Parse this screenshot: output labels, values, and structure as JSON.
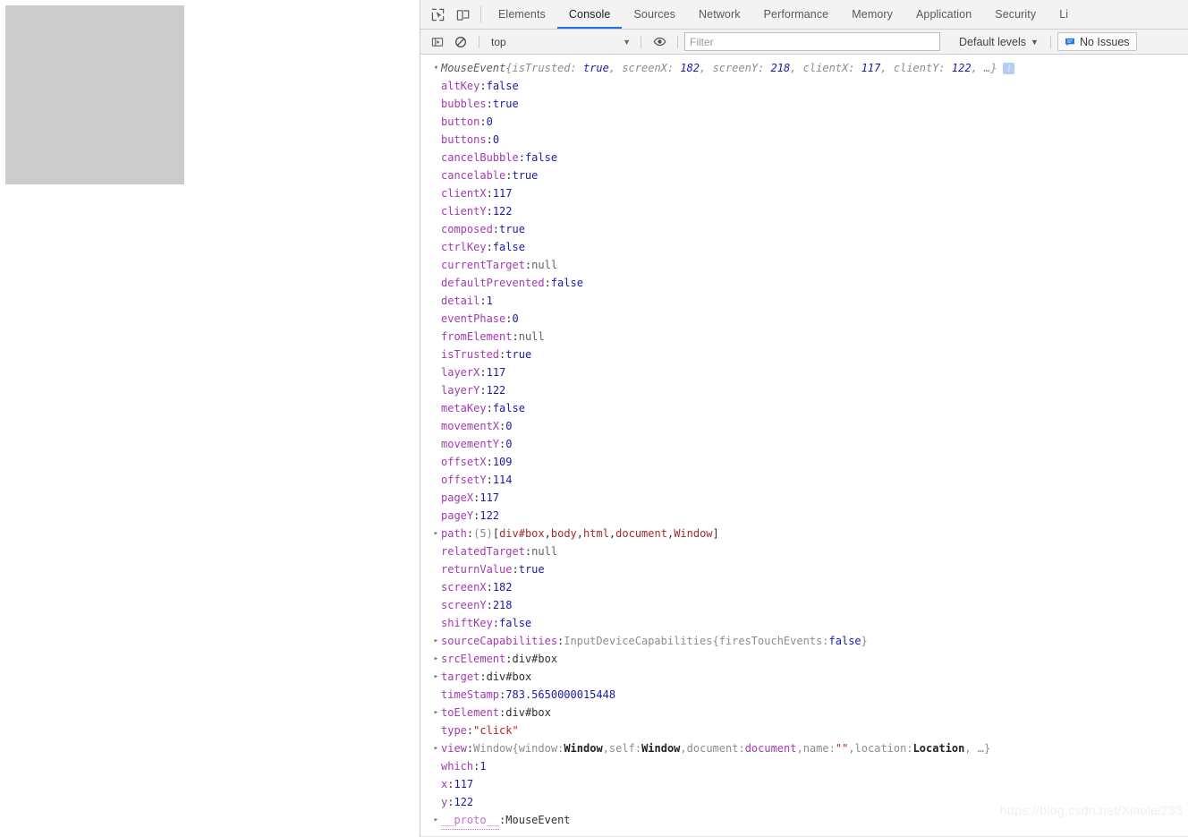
{
  "page": {
    "box_label": "div#box",
    "box_color": "#cccccc"
  },
  "devtools": {
    "toolbar_icons": [
      {
        "name": "inspect-element-icon",
        "glyph": "inspect"
      },
      {
        "name": "device-toolbar-icon",
        "glyph": "device"
      }
    ],
    "tabs": [
      {
        "label": "Elements",
        "active": false
      },
      {
        "label": "Console",
        "active": true
      },
      {
        "label": "Sources",
        "active": false
      },
      {
        "label": "Network",
        "active": false
      },
      {
        "label": "Performance",
        "active": false
      },
      {
        "label": "Memory",
        "active": false
      },
      {
        "label": "Application",
        "active": false
      },
      {
        "label": "Security",
        "active": false
      },
      {
        "label": "Li",
        "active": false
      }
    ]
  },
  "console_toolbar": {
    "sidebar_toggle_icon": "console-sidebar-icon",
    "clear_console_icon": "clear-console-icon",
    "context": "top",
    "context_caret": "▼",
    "eye_icon": "live-expression-eye-icon",
    "filter_placeholder": "Filter",
    "filter_value": "",
    "levels_label": "Default levels",
    "levels_caret": "▼",
    "issues_icon": "issues-message-icon",
    "issues_label": "No Issues",
    "issues_accent": "#1a73e8"
  },
  "console_log": {
    "header": {
      "arrow": "▾",
      "class_name": "MouseEvent",
      "preview_open": " {",
      "preview_items": [
        {
          "key": "isTrusted",
          "sep": ": ",
          "value": "true",
          "kind": "bool"
        },
        {
          "key": "screenX",
          "sep": ": ",
          "value": "182",
          "kind": "num"
        },
        {
          "key": "screenY",
          "sep": ": ",
          "value": "218",
          "kind": "num"
        },
        {
          "key": "clientX",
          "sep": ": ",
          "value": "117",
          "kind": "num"
        },
        {
          "key": "clientY",
          "sep": ": ",
          "value": "122",
          "kind": "num"
        }
      ],
      "preview_ellipsis": ", …}",
      "info_badge": "i"
    },
    "properties": [
      {
        "expandable": false,
        "name": "altKey",
        "value": "false",
        "kind": "bool"
      },
      {
        "expandable": false,
        "name": "bubbles",
        "value": "true",
        "kind": "bool"
      },
      {
        "expandable": false,
        "name": "button",
        "value": "0",
        "kind": "num"
      },
      {
        "expandable": false,
        "name": "buttons",
        "value": "0",
        "kind": "num"
      },
      {
        "expandable": false,
        "name": "cancelBubble",
        "value": "false",
        "kind": "bool"
      },
      {
        "expandable": false,
        "name": "cancelable",
        "value": "true",
        "kind": "bool"
      },
      {
        "expandable": false,
        "name": "clientX",
        "value": "117",
        "kind": "num"
      },
      {
        "expandable": false,
        "name": "clientY",
        "value": "122",
        "kind": "num"
      },
      {
        "expandable": false,
        "name": "composed",
        "value": "true",
        "kind": "bool"
      },
      {
        "expandable": false,
        "name": "ctrlKey",
        "value": "false",
        "kind": "bool"
      },
      {
        "expandable": false,
        "name": "currentTarget",
        "value": "null",
        "kind": "null"
      },
      {
        "expandable": false,
        "name": "defaultPrevented",
        "value": "false",
        "kind": "bool"
      },
      {
        "expandable": false,
        "name": "detail",
        "value": "1",
        "kind": "num"
      },
      {
        "expandable": false,
        "name": "eventPhase",
        "value": "0",
        "kind": "num"
      },
      {
        "expandable": false,
        "name": "fromElement",
        "value": "null",
        "kind": "null"
      },
      {
        "expandable": false,
        "name": "isTrusted",
        "value": "true",
        "kind": "bool"
      },
      {
        "expandable": false,
        "name": "layerX",
        "value": "117",
        "kind": "num"
      },
      {
        "expandable": false,
        "name": "layerY",
        "value": "122",
        "kind": "num"
      },
      {
        "expandable": false,
        "name": "metaKey",
        "value": "false",
        "kind": "bool"
      },
      {
        "expandable": false,
        "name": "movementX",
        "value": "0",
        "kind": "num"
      },
      {
        "expandable": false,
        "name": "movementY",
        "value": "0",
        "kind": "num"
      },
      {
        "expandable": false,
        "name": "offsetX",
        "value": "109",
        "kind": "num"
      },
      {
        "expandable": false,
        "name": "offsetY",
        "value": "114",
        "kind": "num"
      },
      {
        "expandable": false,
        "name": "pageX",
        "value": "117",
        "kind": "num"
      },
      {
        "expandable": false,
        "name": "pageY",
        "value": "122",
        "kind": "num"
      },
      {
        "expandable": true,
        "name": "path",
        "value": "",
        "kind": "path",
        "path_count": "(5)",
        "path_open": " [",
        "path_items": [
          "div#box",
          "body",
          "html",
          "document",
          "Window"
        ],
        "path_close": "]"
      },
      {
        "expandable": false,
        "name": "relatedTarget",
        "value": "null",
        "kind": "null"
      },
      {
        "expandable": false,
        "name": "returnValue",
        "value": "true",
        "kind": "bool"
      },
      {
        "expandable": false,
        "name": "screenX",
        "value": "182",
        "kind": "num"
      },
      {
        "expandable": false,
        "name": "screenY",
        "value": "218",
        "kind": "num"
      },
      {
        "expandable": false,
        "name": "shiftKey",
        "value": "false",
        "kind": "bool"
      },
      {
        "expandable": true,
        "name": "sourceCapabilities",
        "value": "",
        "kind": "caps",
        "caps_class": "InputDeviceCapabilities",
        "caps_open": " {",
        "caps_key": "firesTouchEvents",
        "caps_sep": ": ",
        "caps_value": "false",
        "caps_close": "}"
      },
      {
        "expandable": true,
        "name": "srcElement",
        "value": "div#box",
        "kind": "node"
      },
      {
        "expandable": true,
        "name": "target",
        "value": "div#box",
        "kind": "node"
      },
      {
        "expandable": false,
        "name": "timeStamp",
        "value": "783.5650000015448",
        "kind": "num"
      },
      {
        "expandable": true,
        "name": "toElement",
        "value": "div#box",
        "kind": "node"
      },
      {
        "expandable": false,
        "name": "type",
        "value": "\"click\"",
        "kind": "str"
      },
      {
        "expandable": true,
        "name": "view",
        "value": "",
        "kind": "view",
        "view_class": "Window",
        "view_open": " {",
        "view_items": [
          {
            "key": "window",
            "value": "Window",
            "kind": "dark"
          },
          {
            "key": "self",
            "value": "Window",
            "kind": "dark"
          },
          {
            "key": "document",
            "value": "document",
            "kind": "purple"
          },
          {
            "key": "name",
            "value": "\"\"",
            "kind": "str"
          },
          {
            "key": "location",
            "value": "Location",
            "kind": "dark"
          }
        ],
        "view_ellipsis": ", …}"
      },
      {
        "expandable": false,
        "name": "which",
        "value": "1",
        "kind": "num"
      },
      {
        "expandable": false,
        "name": "x",
        "value": "117",
        "kind": "num"
      },
      {
        "expandable": false,
        "name": "y",
        "value": "122",
        "kind": "num"
      },
      {
        "expandable": true,
        "name": "__proto__",
        "value": "MouseEvent",
        "kind": "proto"
      }
    ]
  },
  "watermark": {
    "text": "https://blog.csdn.net/Xiaolei233"
  }
}
